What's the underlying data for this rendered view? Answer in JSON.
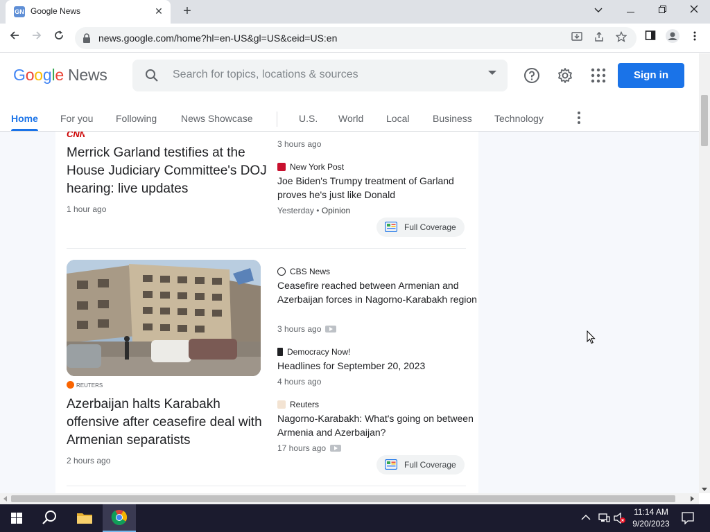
{
  "browser": {
    "tab_title": "Google News",
    "tab_favicon": "GN",
    "url": "news.google.com/home?hl=en-US&gl=US&ceid=US:en"
  },
  "header": {
    "logo_google": [
      "G",
      "o",
      "o",
      "g",
      "l",
      "e"
    ],
    "logo_news": "News",
    "search_placeholder": "Search for topics, locations & sources",
    "sign_in": "Sign in"
  },
  "nav": {
    "tabs": [
      "Home",
      "For you",
      "Following",
      "News Showcase",
      "U.S.",
      "World",
      "Local",
      "Business",
      "Technology"
    ],
    "active": "Home"
  },
  "story1": {
    "source_logo": "CNN",
    "headline": "Merrick Garland testifies at the House Judiciary Committee's DOJ hearing: live updates",
    "time": "1 hour ago",
    "partial_time": "3 hours ago",
    "related": [
      {
        "source": "New York Post",
        "headline": "Joe Biden's Trumpy treatment of Garland proves he's just like Donald",
        "time": "Yesterday",
        "tag": "Opinion"
      }
    ],
    "full_coverage": "Full Coverage"
  },
  "story2": {
    "source_logo": "REUTERS",
    "headline": "Azerbaijan halts Karabakh offensive after ceasefire deal with Armenian separatists",
    "time": "2 hours ago",
    "related": [
      {
        "source": "CBS News",
        "headline": "Ceasefire reached between Armenian and Azerbaijan forces in Nagorno-Karabakh region",
        "time": "3 hours ago"
      },
      {
        "source": "Democracy Now!",
        "headline": "Headlines for September 20, 2023",
        "time": "4 hours ago"
      },
      {
        "source": "Reuters",
        "headline": "Nagorno-Karabakh: What's going on between Armenia and Azerbaijan?",
        "time": "17 hours ago"
      }
    ],
    "full_coverage": "Full Coverage"
  },
  "taskbar": {
    "time": "11:14 AM",
    "date": "9/20/2023"
  },
  "colors": {
    "accent": "#1a73e8",
    "taskbar": "#1b1b2e",
    "cnn": "#cc0000"
  }
}
